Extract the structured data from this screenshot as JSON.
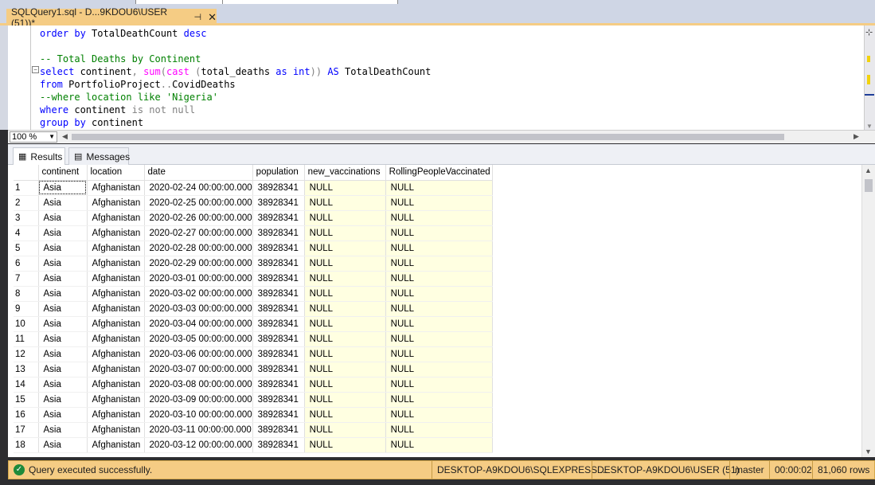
{
  "tab": {
    "title": "SQLQuery1.sql - D...9KDOU6\\USER (51))*",
    "pin": "⊣",
    "close": "✕"
  },
  "editor": {
    "lines": [
      [
        {
          "c": "kw",
          "t": "order by "
        },
        {
          "c": "tx",
          "t": "TotalDeathCount "
        },
        {
          "c": "kw",
          "t": "desc"
        }
      ],
      [],
      [
        {
          "c": "cm",
          "t": "-- Total Deaths by Continent"
        }
      ],
      [
        {
          "c": "kw",
          "t": "select "
        },
        {
          "c": "tx",
          "t": "continent"
        },
        {
          "c": "gr",
          "t": ", "
        },
        {
          "c": "fn",
          "t": "sum"
        },
        {
          "c": "gr",
          "t": "("
        },
        {
          "c": "fn",
          "t": "cast "
        },
        {
          "c": "gr",
          "t": "("
        },
        {
          "c": "tx",
          "t": "total_deaths "
        },
        {
          "c": "kw",
          "t": "as int"
        },
        {
          "c": "gr",
          "t": ")) "
        },
        {
          "c": "kw",
          "t": "AS "
        },
        {
          "c": "tx",
          "t": "TotalDeathCount"
        }
      ],
      [
        {
          "c": "kw",
          "t": "from "
        },
        {
          "c": "tx",
          "t": "PortfolioProject"
        },
        {
          "c": "gr",
          "t": ".."
        },
        {
          "c": "tx",
          "t": "CovidDeaths"
        }
      ],
      [
        {
          "c": "cm",
          "t": "--where location like "
        },
        {
          "c": "cm",
          "t": "'Nigeria'"
        }
      ],
      [
        {
          "c": "kw",
          "t": "where "
        },
        {
          "c": "tx",
          "t": "continent "
        },
        {
          "c": "gr",
          "t": "is not null"
        }
      ],
      [
        {
          "c": "kw",
          "t": "group by "
        },
        {
          "c": "tx",
          "t": "continent"
        }
      ]
    ]
  },
  "zoom": {
    "value": "100 %"
  },
  "results_tabs": [
    {
      "label": "Results",
      "icon": "grid-icon"
    },
    {
      "label": "Messages",
      "icon": "messages-icon"
    }
  ],
  "grid": {
    "columns": [
      "continent",
      "location",
      "date",
      "population",
      "new_vaccinations",
      "RollingPeopleVaccinated"
    ],
    "rows": [
      [
        "1",
        "Asia",
        "Afghanistan",
        "2020-02-24 00:00:00.000",
        "38928341",
        "NULL",
        "NULL"
      ],
      [
        "2",
        "Asia",
        "Afghanistan",
        "2020-02-25 00:00:00.000",
        "38928341",
        "NULL",
        "NULL"
      ],
      [
        "3",
        "Asia",
        "Afghanistan",
        "2020-02-26 00:00:00.000",
        "38928341",
        "NULL",
        "NULL"
      ],
      [
        "4",
        "Asia",
        "Afghanistan",
        "2020-02-27 00:00:00.000",
        "38928341",
        "NULL",
        "NULL"
      ],
      [
        "5",
        "Asia",
        "Afghanistan",
        "2020-02-28 00:00:00.000",
        "38928341",
        "NULL",
        "NULL"
      ],
      [
        "6",
        "Asia",
        "Afghanistan",
        "2020-02-29 00:00:00.000",
        "38928341",
        "NULL",
        "NULL"
      ],
      [
        "7",
        "Asia",
        "Afghanistan",
        "2020-03-01 00:00:00.000",
        "38928341",
        "NULL",
        "NULL"
      ],
      [
        "8",
        "Asia",
        "Afghanistan",
        "2020-03-02 00:00:00.000",
        "38928341",
        "NULL",
        "NULL"
      ],
      [
        "9",
        "Asia",
        "Afghanistan",
        "2020-03-03 00:00:00.000",
        "38928341",
        "NULL",
        "NULL"
      ],
      [
        "10",
        "Asia",
        "Afghanistan",
        "2020-03-04 00:00:00.000",
        "38928341",
        "NULL",
        "NULL"
      ],
      [
        "11",
        "Asia",
        "Afghanistan",
        "2020-03-05 00:00:00.000",
        "38928341",
        "NULL",
        "NULL"
      ],
      [
        "12",
        "Asia",
        "Afghanistan",
        "2020-03-06 00:00:00.000",
        "38928341",
        "NULL",
        "NULL"
      ],
      [
        "13",
        "Asia",
        "Afghanistan",
        "2020-03-07 00:00:00.000",
        "38928341",
        "NULL",
        "NULL"
      ],
      [
        "14",
        "Asia",
        "Afghanistan",
        "2020-03-08 00:00:00.000",
        "38928341",
        "NULL",
        "NULL"
      ],
      [
        "15",
        "Asia",
        "Afghanistan",
        "2020-03-09 00:00:00.000",
        "38928341",
        "NULL",
        "NULL"
      ],
      [
        "16",
        "Asia",
        "Afghanistan",
        "2020-03-10 00:00:00.000",
        "38928341",
        "NULL",
        "NULL"
      ],
      [
        "17",
        "Asia",
        "Afghanistan",
        "2020-03-11 00:00:00.000",
        "38928341",
        "NULL",
        "NULL"
      ],
      [
        "18",
        "Asia",
        "Afghanistan",
        "2020-03-12 00:00:00.000",
        "38928341",
        "NULL",
        "NULL"
      ]
    ]
  },
  "status": {
    "icon": "check-icon",
    "message": "Query executed successfully.",
    "server": "DESKTOP-A9KDOU6\\SQLEXPRESS ...",
    "user": "DESKTOP-A9KDOU6\\USER (51)",
    "database": "master",
    "elapsed": "00:00:02",
    "rows": "81,060 rows"
  },
  "colors": {
    "accent": "#f5cc84",
    "null_cell": "#ffffe1",
    "tabstrip": "#cfd6e5"
  }
}
